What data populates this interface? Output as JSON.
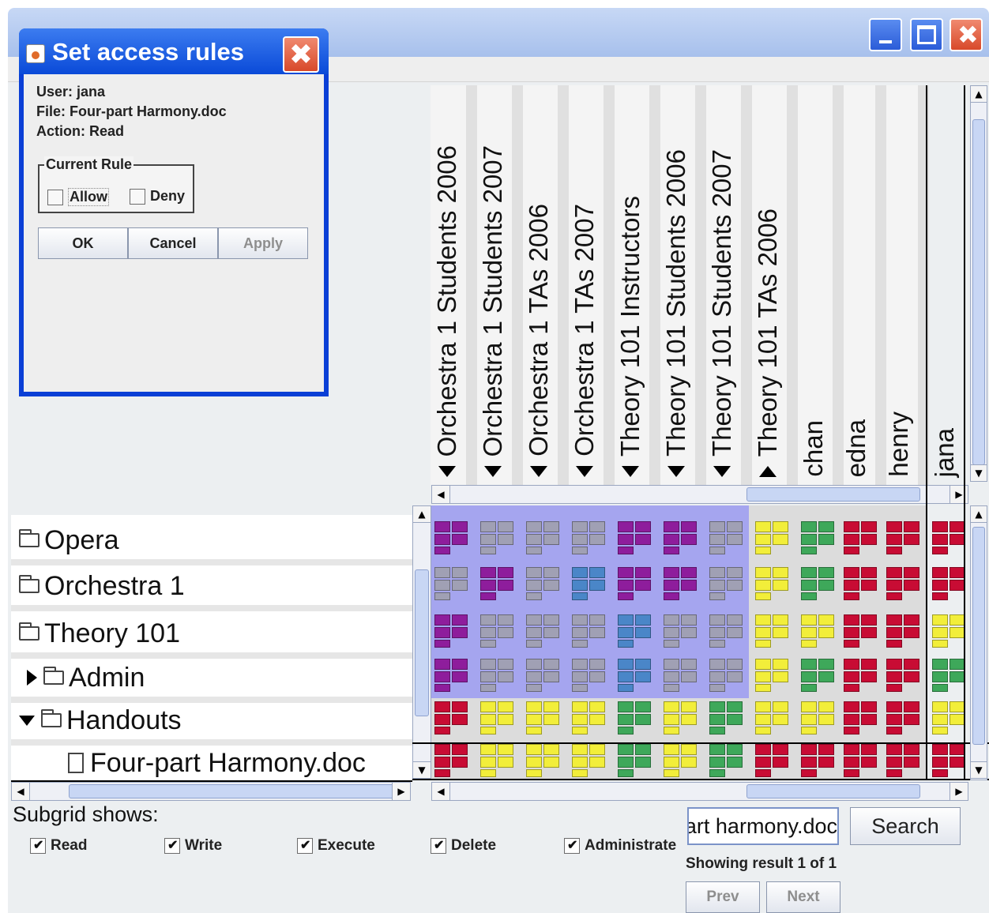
{
  "dialog": {
    "title": "Set access rules",
    "user": "User: jana",
    "file": "File: Four-part Harmony.doc",
    "action": "Action: Read",
    "rule_group": "Current Rule",
    "allow_label": "Allow",
    "deny_label": "Deny",
    "ok_label": "OK",
    "cancel_label": "Cancel",
    "apply_label": "Apply"
  },
  "columns": [
    {
      "label": "Orchestra 1 Students 2006",
      "arrow": "up"
    },
    {
      "label": "Orchestra 1 Students 2007",
      "arrow": "up"
    },
    {
      "label": "Orchestra 1 TAs 2006",
      "arrow": "up"
    },
    {
      "label": "Orchestra 1 TAs 2007",
      "arrow": "up"
    },
    {
      "label": "Theory 101 Instructors",
      "arrow": "up"
    },
    {
      "label": "Theory 101 Students 2006",
      "arrow": "up"
    },
    {
      "label": "Theory 101 Students 2007",
      "arrow": "up"
    },
    {
      "label": "Theory 101 TAs 2006",
      "arrow": "down"
    },
    {
      "label": "chan",
      "arrow": ""
    },
    {
      "label": "edna",
      "arrow": ""
    },
    {
      "label": "henry",
      "arrow": ""
    },
    {
      "label": "jana",
      "arrow": ""
    }
  ],
  "tree": [
    {
      "label": "Opera",
      "icon": "folder-icon",
      "expander": ""
    },
    {
      "label": "Orchestra 1",
      "icon": "folder-icon",
      "expander": ""
    },
    {
      "label": "Theory 101",
      "icon": "folder-icon",
      "expander": ""
    },
    {
      "label": "Admin",
      "icon": "folder-icon",
      "expander": "collapsed"
    },
    {
      "label": "Handouts",
      "icon": "folder-icon",
      "expander": "expanded"
    },
    {
      "label": "Four-part Harmony.doc",
      "icon": "file-icon",
      "expander": ""
    }
  ],
  "grid": {
    "colors": {
      "purple": "#8e1d9c",
      "gray": "#a0a0b4",
      "blue": "#4a86c8",
      "yellow": "#f2ee3a",
      "green": "#3ea85a",
      "red": "#c80c34"
    },
    "rows": [
      [
        "purple",
        "gray",
        "gray",
        "gray",
        "purple",
        "purple",
        "gray",
        "yellow",
        "green",
        "red",
        "red",
        "red"
      ],
      [
        "gray",
        "purple",
        "gray",
        "blue",
        "purple",
        "purple",
        "gray",
        "yellow",
        "green",
        "red",
        "red",
        "red"
      ],
      [
        "purple",
        "gray",
        "gray",
        "gray",
        "blue",
        "gray",
        "gray",
        "yellow",
        "yellow",
        "red",
        "red",
        "yellow"
      ],
      [
        "purple",
        "gray",
        "gray",
        "gray",
        "blue",
        "gray",
        "gray",
        "yellow",
        "green",
        "red",
        "red",
        "green"
      ],
      [
        "red",
        "yellow",
        "yellow",
        "yellow",
        "green",
        "yellow",
        "green",
        "yellow",
        "yellow",
        "red",
        "red",
        "yellow"
      ],
      [
        "red",
        "yellow",
        "yellow",
        "yellow",
        "green",
        "yellow",
        "green",
        "red",
        "red",
        "red",
        "red",
        "red"
      ]
    ]
  },
  "subgrid": {
    "label": "Subgrid shows:",
    "options": [
      {
        "label": "Read",
        "checked": true
      },
      {
        "label": "Write",
        "checked": true
      },
      {
        "label": "Execute",
        "checked": true
      },
      {
        "label": "Delete",
        "checked": true
      },
      {
        "label": "Administrate",
        "checked": true
      }
    ]
  },
  "search": {
    "value": "four-part harmony.doc",
    "button_label": "Search",
    "result_text": "Showing result 1 of 1",
    "prev_label": "Prev",
    "next_label": "Next"
  }
}
